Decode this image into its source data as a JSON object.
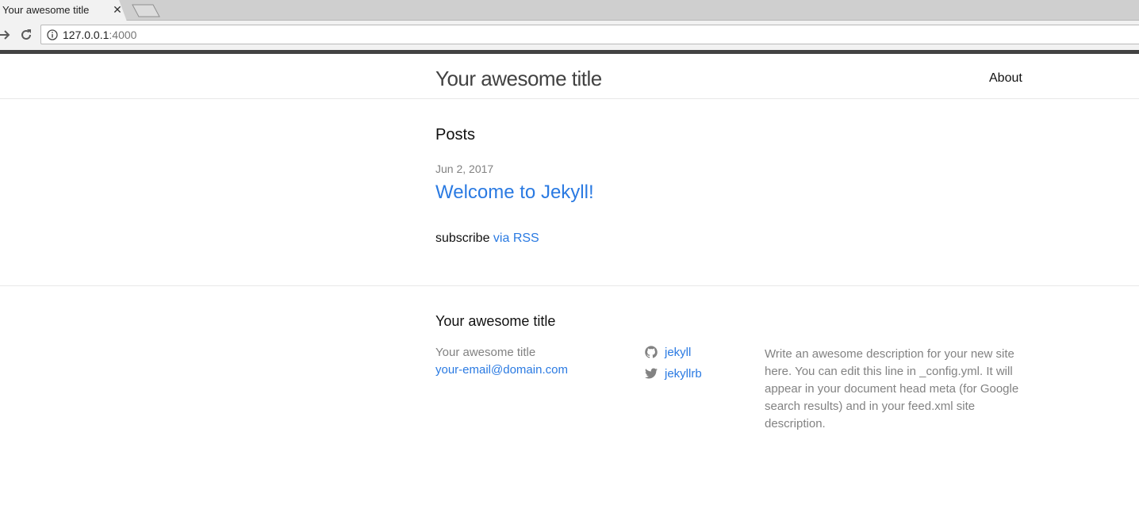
{
  "browser": {
    "tab_title": "Your awesome title",
    "tab_close_icon": "close-icon",
    "url_host": "127.0.0.1",
    "url_port": ":4000"
  },
  "header": {
    "site_title": "Your awesome title",
    "nav": [
      {
        "label": "About"
      }
    ]
  },
  "main": {
    "posts_heading": "Posts",
    "posts": [
      {
        "date": "Jun 2, 2017",
        "title": "Welcome to Jekyll!"
      }
    ],
    "subscribe_text": "subscribe ",
    "rss_link": "via RSS"
  },
  "footer": {
    "heading": "Your awesome title",
    "name": "Your awesome title",
    "email": "your-email@domain.com",
    "social": [
      {
        "icon": "github-icon",
        "label": "jekyll"
      },
      {
        "icon": "twitter-icon",
        "label": "jekyllrb"
      }
    ],
    "description": "Write an awesome description for your new site here. You can edit this line in _config.yml. It will appear in your document head meta (for Google search results) and in your feed.xml site description."
  },
  "colors": {
    "link": "#2a7ae2",
    "muted": "#828282",
    "header_border": "#424242"
  }
}
